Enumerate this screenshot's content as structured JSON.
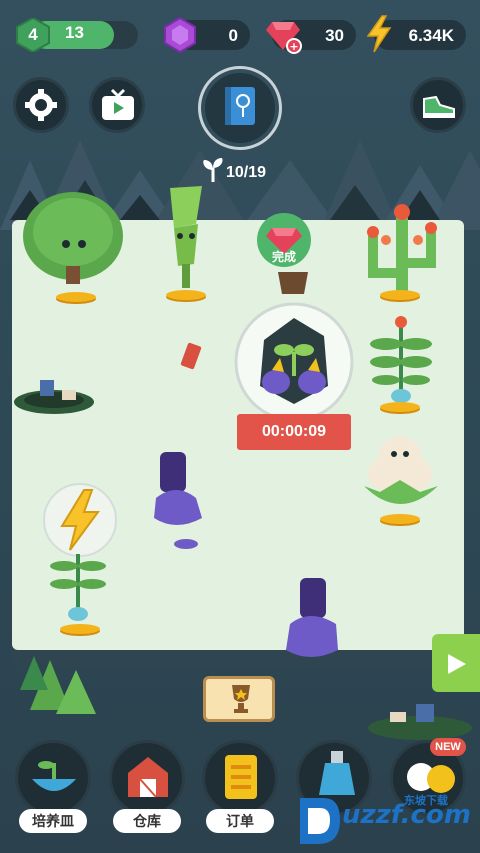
{
  "hud": {
    "level": "4",
    "level_progress": 0.78,
    "xp": "13",
    "gems_purple": "0",
    "gems_red": "30",
    "energy": "6.34K",
    "sprout_count": "10/19"
  },
  "board": {
    "done_label": "完成",
    "timer": "00:00:09"
  },
  "nav": {
    "dish": "培养皿",
    "storage": "仓库",
    "orders": "订单",
    "new_badge": "NEW"
  },
  "watermark": {
    "brand": "uzzf.com",
    "tag": "东坡下载"
  },
  "colors": {
    "board": "#e3f1e1",
    "accent_green": "#4fb56a",
    "ribbon_red": "#e2544a",
    "gold": "#f3b41b"
  },
  "icons": [
    "settings-gear-icon",
    "video-tv-icon",
    "plant-book-icon",
    "sneaker-icon",
    "gem-purple-icon",
    "gem-red-icon",
    "lightning-icon",
    "trophy-icon",
    "play-arrow-icon"
  ]
}
